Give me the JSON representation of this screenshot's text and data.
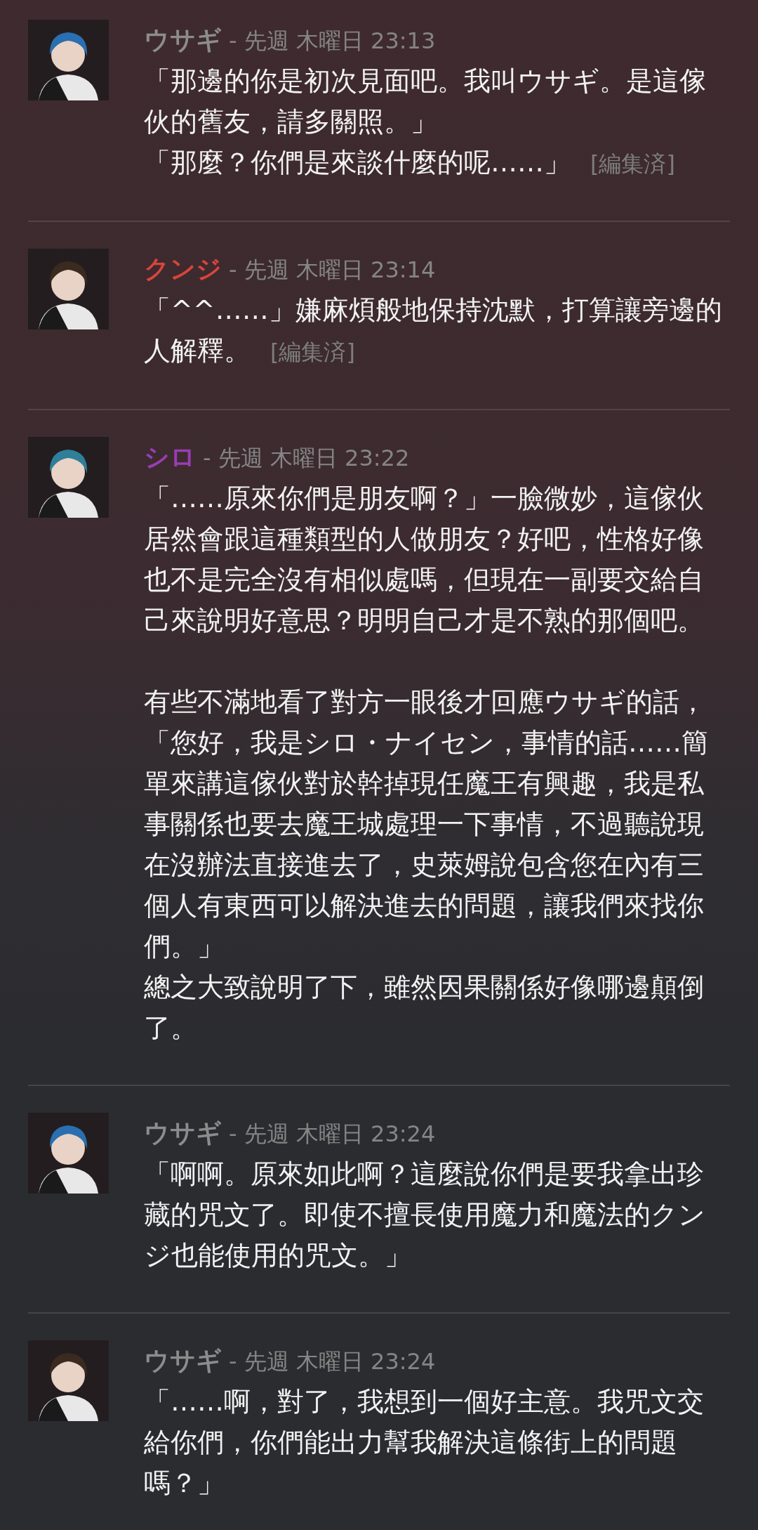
{
  "messages": [
    {
      "author": "ウサギ",
      "color": "#8c8c8c",
      "meta": "- 先週 木曜日 23:13",
      "blocks": [
        [
          "「那邊的你是初次見面吧。我叫ウサギ。是這傢伙的舊友，請多關照。」",
          "「那麼？你們是來談什麼的呢……」"
        ]
      ],
      "edited_label": "[編集済]"
    },
    {
      "author": "クンジ",
      "color": "#d9443b",
      "meta": "- 先週 木曜日 23:14",
      "blocks": [
        [
          "「^^……」嫌麻煩般地保持沈默，打算讓旁邊的",
          "人解釋。"
        ]
      ],
      "edited_label": "[編集済]"
    },
    {
      "author": "シロ",
      "color": "#9a3db3",
      "meta": "- 先週 木曜日 23:22",
      "blocks": [
        [
          "「……原來你們是朋友啊？」一臉微妙，這傢伙居然會跟這種類型的人做朋友？好吧，性格好像也不是完全沒有相似處嗎，但現在一副要交給自己來說明好意思？明明自己才是不熟的那個吧。"
        ],
        [
          "有些不滿地看了對方一眼後才回應ウサギ的話，「您好，我是シロ・ナイセン，事情的話……簡單來講這傢伙對於幹掉現任魔王有興趣，我是私事關係也要去魔王城處理一下事情，不過聽說現在沒辦法直接進去了，史萊姆說包含您在內有三個人有東西可以解決進去的問題，讓我們來找你們。」",
          "總之大致說明了下，雖然因果關係好像哪邊顛倒了。"
        ]
      ]
    },
    {
      "author": "ウサギ",
      "color": "#8c8c8c",
      "meta": "- 先週 木曜日 23:24",
      "blocks": [
        [
          "「啊啊。原來如此啊？這麼說你們是要我拿出珍藏的咒文了。即使不擅長使用魔力和魔法的クンジ也能使用的咒文。」"
        ]
      ]
    },
    {
      "author": "ウサギ",
      "color": "#8c8c8c",
      "meta": "- 先週 木曜日 23:24",
      "blocks": [
        [
          "「……啊，對了，我想到一個好主意。我咒文交給你們，你們能出力幫我解決這條街上的問題嗎？」"
        ]
      ]
    }
  ]
}
